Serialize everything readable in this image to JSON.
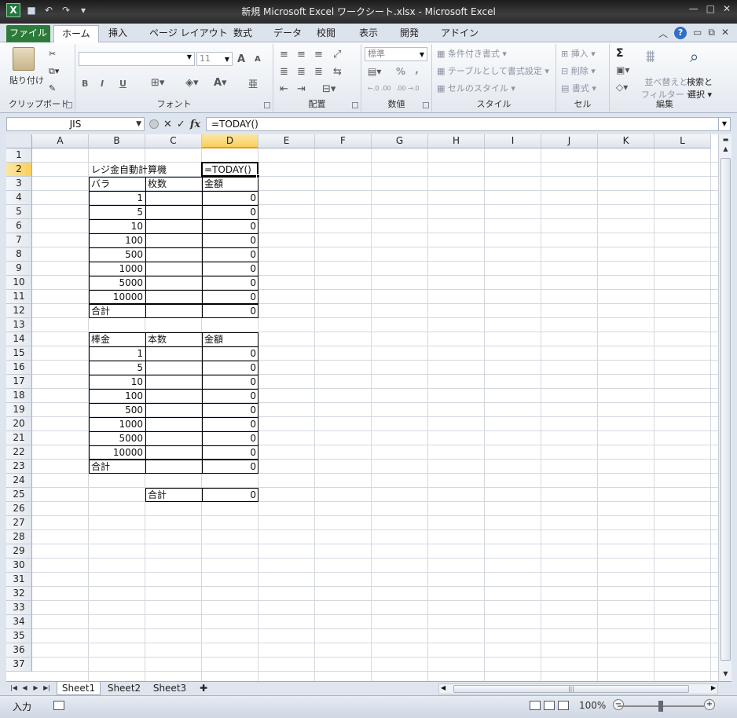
{
  "titlebar": {
    "title": "新規 Microsoft Excel ワークシート.xlsx - Microsoft Excel",
    "logo": "X"
  },
  "ribbon_tabs": [
    "ファイル",
    "ホーム",
    "挿入",
    "ページ レイアウト",
    "数式",
    "データ",
    "校閲",
    "表示",
    "開発",
    "アドイン"
  ],
  "ribbon": {
    "clipboard": {
      "paste": "貼り付け",
      "label": "クリップボード"
    },
    "font": {
      "size": "11",
      "bold": "B",
      "italic": "I",
      "underline": "U",
      "grow": "A",
      "shrink": "A",
      "label": "フォント",
      "phonetic": "亜"
    },
    "alignment": {
      "label": "配置"
    },
    "number": {
      "format": "標準",
      "percent": "%",
      "comma": ",",
      "inc": "←.0 .00",
      "dec": ".00 →.0",
      "label": "数値"
    },
    "styles": {
      "conditional": "条件付き書式",
      "table": "テーブルとして書式設定",
      "cellstyle": "セルのスタイル",
      "label": "スタイル"
    },
    "cells": {
      "insert": "挿入",
      "delete": "削除",
      "format": "書式",
      "label": "セル"
    },
    "editing": {
      "sum": "Σ",
      "sort_line1": "並べ替えと",
      "sort_line2": "フィルター",
      "find_line1": "検索と",
      "find_line2": "選択",
      "label": "編集"
    }
  },
  "formula_bar": {
    "name_box": "JIS",
    "formula": "=TODAY()",
    "fx": "fx"
  },
  "columns": [
    "A",
    "B",
    "C",
    "D",
    "E",
    "F",
    "G",
    "H",
    "I",
    "J",
    "K",
    "L"
  ],
  "selected_column": "D",
  "selected_row": "2",
  "rows": [
    "1",
    "2",
    "3",
    "4",
    "5",
    "6",
    "7",
    "8",
    "9",
    "10",
    "11",
    "12",
    "13",
    "14",
    "15",
    "16",
    "17",
    "18",
    "19",
    "20",
    "21",
    "22",
    "23",
    "24",
    "25",
    "26",
    "27",
    "28",
    "29",
    "30",
    "31",
    "32",
    "33",
    "34",
    "35",
    "36",
    "37"
  ],
  "cells": {
    "B2": "レジ金自動計算機",
    "D2": "=TODAY()",
    "B3": "バラ",
    "C3": "枚数",
    "D3": "金額",
    "B4": "1",
    "D4": "0",
    "B5": "5",
    "D5": "0",
    "B6": "10",
    "D6": "0",
    "B7": "100",
    "D7": "0",
    "B8": "500",
    "D8": "0",
    "B9": "1000",
    "D9": "0",
    "B10": "5000",
    "D10": "0",
    "B11": "10000",
    "D11": "0",
    "B12": "合計",
    "D12": "0",
    "B14": "棒金",
    "C14": "本数",
    "D14": "金額",
    "B15": "1",
    "D15": "0",
    "B16": "5",
    "D16": "0",
    "B17": "10",
    "D17": "0",
    "B18": "100",
    "D18": "0",
    "B19": "500",
    "D19": "0",
    "B20": "1000",
    "D20": "0",
    "B21": "5000",
    "D21": "0",
    "B22": "10000",
    "D22": "0",
    "B23": "合計",
    "D23": "0",
    "C25": "合計",
    "D25": "0"
  },
  "sheet_tabs": [
    "Sheet1",
    "Sheet2",
    "Sheet3"
  ],
  "active_sheet": "Sheet1",
  "status": {
    "mode": "入力",
    "zoom": "100%"
  }
}
